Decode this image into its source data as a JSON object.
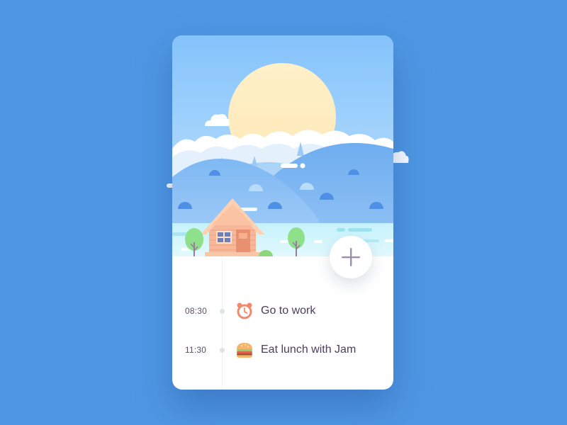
{
  "colors": {
    "background": "#4f97e4",
    "card": "#ffffff",
    "text": "#4a3d5e",
    "time_text": "#5b4e6a",
    "fab_plus": "#9a8fac"
  },
  "fab": {
    "icon": "plus-icon"
  },
  "events": [
    {
      "time": "08:30",
      "title": "Go to work",
      "icon": "alarm-clock-icon"
    },
    {
      "time": "11:30",
      "title": "Eat lunch with Jam",
      "icon": "burger-icon"
    }
  ]
}
